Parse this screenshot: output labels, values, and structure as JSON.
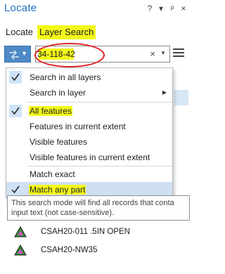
{
  "window": {
    "title": "Locate",
    "buttons": [
      "?",
      "▾",
      "ᵖ",
      "×"
    ]
  },
  "tabs": [
    {
      "label": "Locate",
      "active": false
    },
    {
      "label": "Layer Search",
      "active": true
    }
  ],
  "search": {
    "value": "34-118-42",
    "placeholder": "",
    "clear_icon": "×",
    "dropdown_icon": "▾"
  },
  "colors": {
    "accent": "#4e8ac7",
    "highlight": "#f4f91a",
    "annotation": "#e02020",
    "checkbox_bg": "#cfe3f6"
  },
  "menu": {
    "items": [
      {
        "label": "Search in all layers",
        "checked": true,
        "highlighted": false,
        "submenu": false
      },
      {
        "label": "Search in layer",
        "checked": false,
        "highlighted": false,
        "submenu": true
      },
      {
        "label": "All features",
        "checked": true,
        "highlighted": true,
        "submenu": false
      },
      {
        "label": "Features in current extent",
        "checked": false,
        "highlighted": false,
        "submenu": false
      },
      {
        "label": "Visible features",
        "checked": false,
        "highlighted": false,
        "submenu": false
      },
      {
        "label": "Visible features in current extent",
        "checked": false,
        "highlighted": false,
        "submenu": false
      },
      {
        "label": "Match exact",
        "checked": false,
        "highlighted": false,
        "submenu": false
      },
      {
        "label": "Match any part",
        "checked": true,
        "highlighted": true,
        "submenu": false,
        "hovered": true
      }
    ]
  },
  "tooltip": {
    "line1": "This search mode will find all records that conta",
    "line2": "input text (not case-sensitive)."
  },
  "results": [
    {
      "label": "CSAH20-011 .5IN OPEN",
      "icon": "triangle-feature-icon"
    },
    {
      "label": "CSAH20-NW35",
      "icon": "triangle-feature-icon"
    }
  ]
}
